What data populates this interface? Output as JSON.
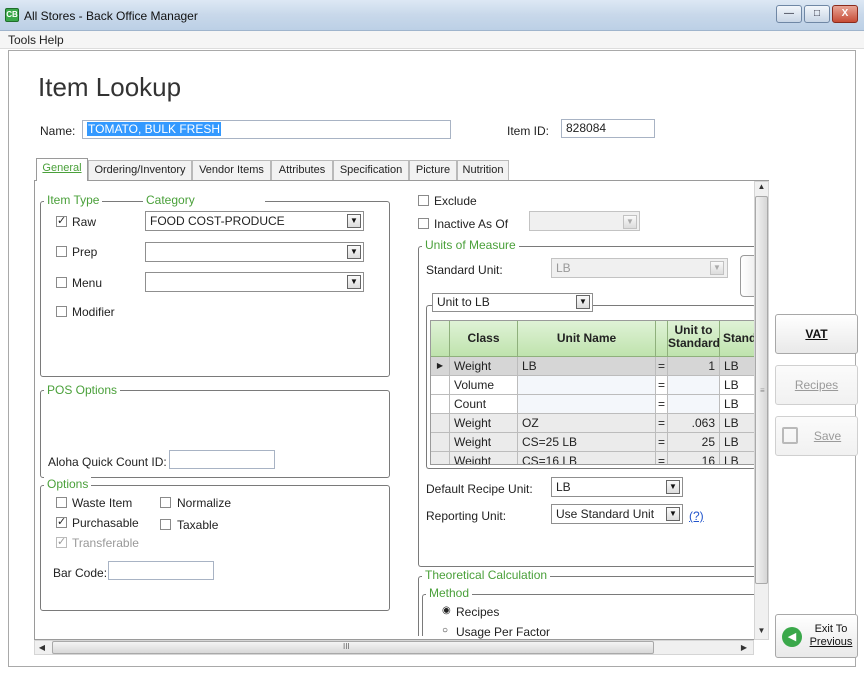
{
  "window": {
    "title": "All Stores - Back Office Manager"
  },
  "menu": [
    "Tools",
    "Help"
  ],
  "page_title": "Item Lookup",
  "name": {
    "label": "Name:",
    "value": "TOMATO, BULK FRESH"
  },
  "item_id": {
    "label": "Item ID:",
    "value": "828084"
  },
  "tabs": [
    "General",
    "Ordering/Inventory",
    "Vendor Items",
    "Attributes",
    "Specification",
    "Picture",
    "Nutrition"
  ],
  "item_type": {
    "legend": "Item Type",
    "category_legend": "Category",
    "rows": [
      {
        "label": "Raw",
        "checked": true,
        "category": "FOOD COST-PRODUCE"
      },
      {
        "label": "Prep",
        "checked": false,
        "category": ""
      },
      {
        "label": "Menu",
        "checked": false,
        "category": ""
      },
      {
        "label": "Modifier",
        "checked": false
      }
    ]
  },
  "pos_options": {
    "legend": "POS Options",
    "aloha_label": "Aloha Quick Count ID:",
    "aloha_value": ""
  },
  "options": {
    "legend": "Options",
    "waste_item": "Waste Item",
    "normalize": "Normalize",
    "purchasable": "Purchasable",
    "taxable": "Taxable",
    "transferable": "Transferable",
    "barcode_label": "Bar Code:",
    "barcode_value": ""
  },
  "exclude": {
    "label": "Exclude"
  },
  "inactive": {
    "label": "Inactive As Of",
    "value": ""
  },
  "units": {
    "legend": "Units of Measure",
    "standard_label": "Standard Unit:",
    "standard_value": "LB",
    "unit_to_value": "Unit to LB",
    "columns": [
      "Class",
      "Unit Name",
      "Unit to Standard",
      "Stand"
    ],
    "rows": [
      {
        "cls": "Weight",
        "name": "LB",
        "eq": "=",
        "qty": "1",
        "std": "LB"
      },
      {
        "cls": "Volume",
        "name": "",
        "eq": "=",
        "qty": "",
        "std": "LB"
      },
      {
        "cls": "Count",
        "name": "",
        "eq": "=",
        "qty": "",
        "std": "LB"
      },
      {
        "cls": "Weight",
        "name": "OZ",
        "eq": "=",
        "qty": ".063",
        "std": "LB"
      },
      {
        "cls": "Weight",
        "name": "CS=25 LB",
        "eq": "=",
        "qty": "25",
        "std": "LB"
      },
      {
        "cls": "Weight",
        "name": "CS=16 LB",
        "eq": "=",
        "qty": "16",
        "std": "LB"
      }
    ],
    "default_recipe_label": "Default Recipe Unit:",
    "default_recipe_value": "LB",
    "reporting_label": "Reporting Unit:",
    "reporting_value": "Use Standard Unit",
    "help_link": "(?)"
  },
  "theoretical": {
    "legend": "Theoretical Calculation",
    "method_legend": "Method",
    "recipes": "Recipes",
    "usage": "Usage Per Factor"
  },
  "buttons": {
    "vat": "VAT",
    "recipes": "Recipes",
    "save": "Save",
    "exit_line1": "Exit To",
    "exit_line2": "Previous"
  },
  "scroll": {
    "bottom_grip": "III"
  },
  "colors": {
    "accent_green": "#4aa03a",
    "selection": "#3399ff",
    "grid_header": "#bfe3ad"
  }
}
